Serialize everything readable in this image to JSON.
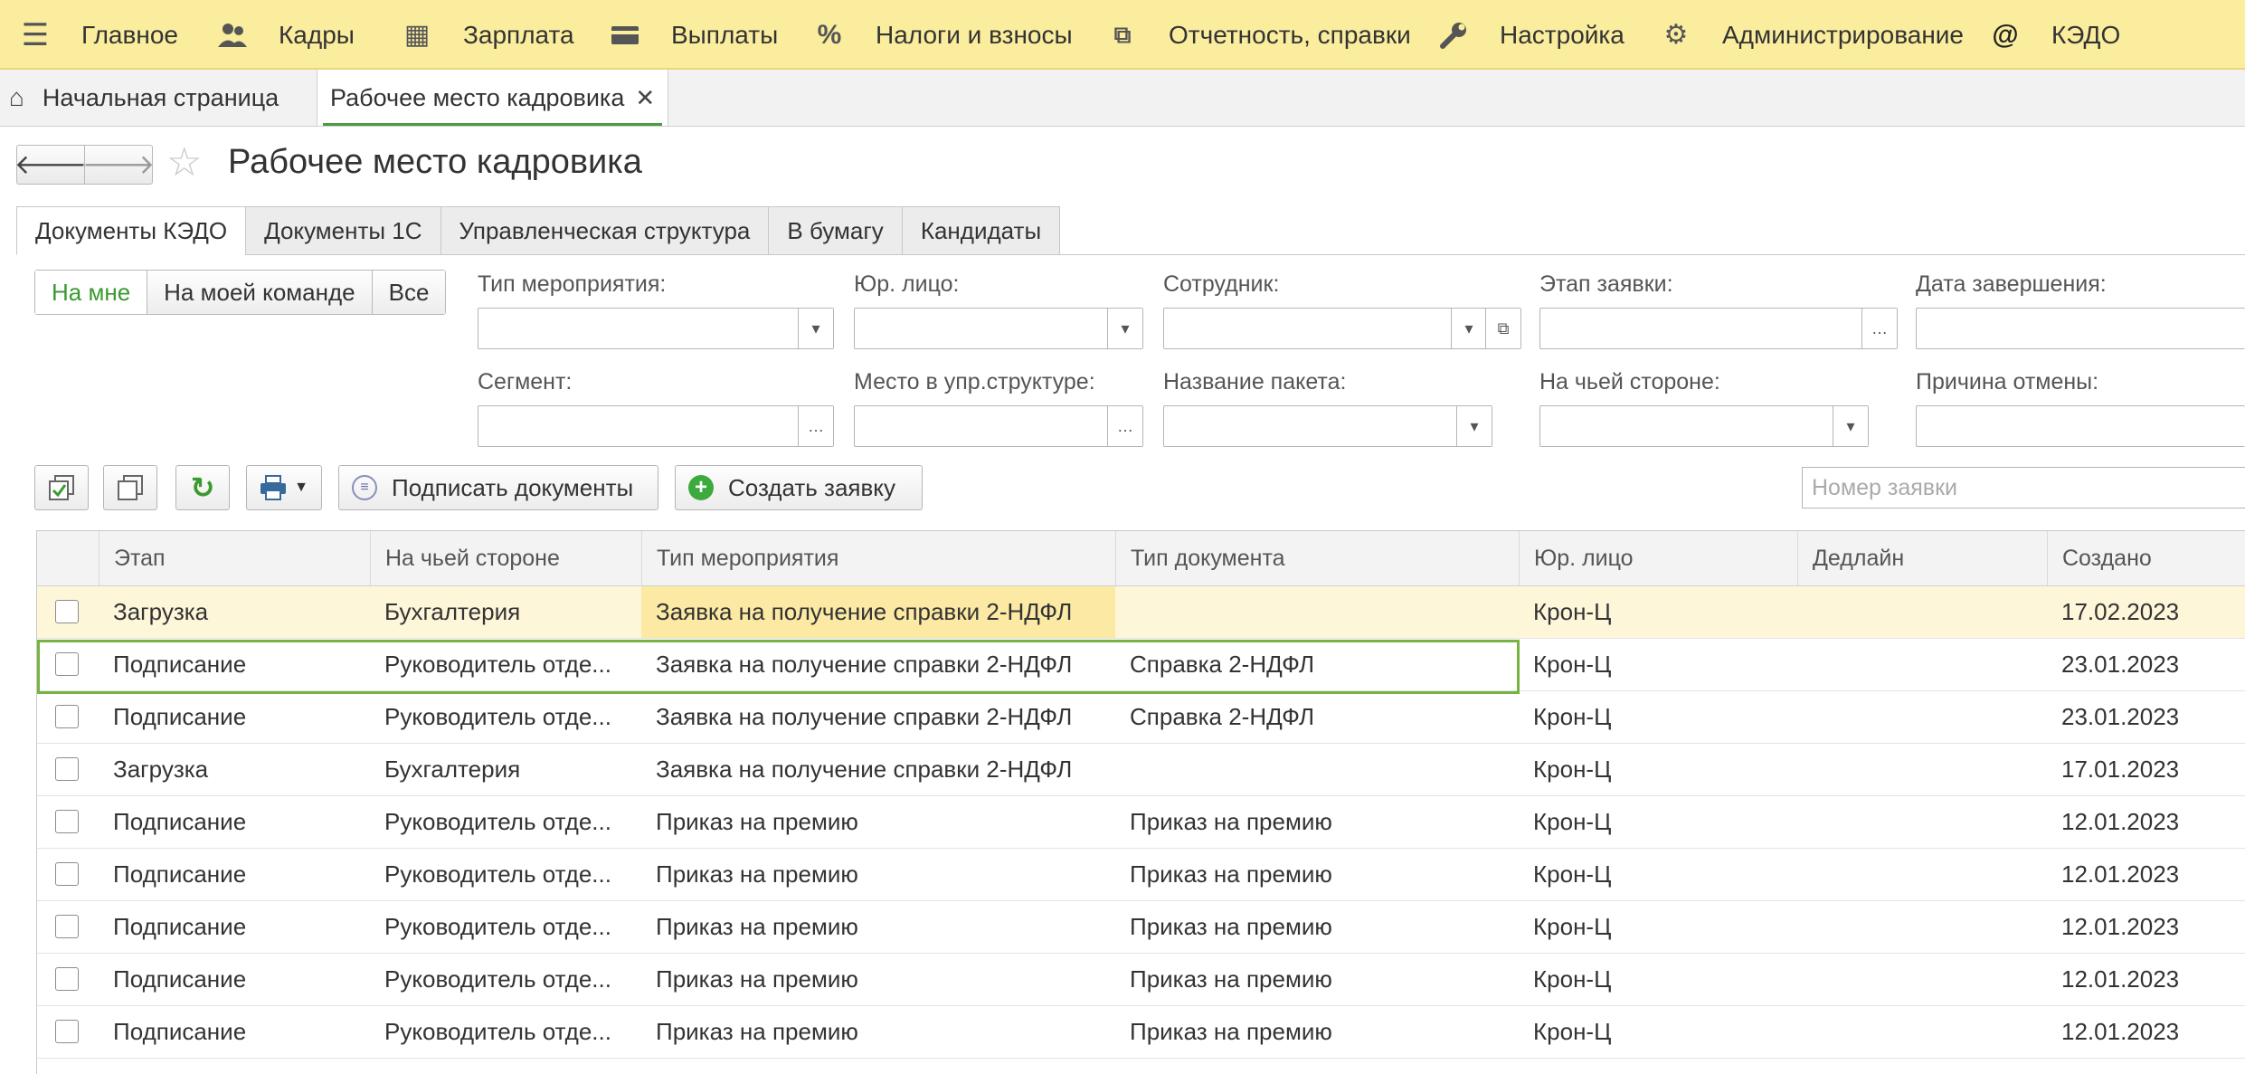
{
  "menu": [
    {
      "label": "Главное",
      "icon": "menu-icon"
    },
    {
      "label": "Кадры",
      "icon": "people-icon"
    },
    {
      "label": "Зарплата",
      "icon": "calculator-icon"
    },
    {
      "label": "Выплаты",
      "icon": "wallet-icon"
    },
    {
      "label": "Налоги и взносы",
      "icon": "percent-icon"
    },
    {
      "label": "Отчетность, справки",
      "icon": "documents-icon"
    },
    {
      "label": "Настройка",
      "icon": "wrench-icon"
    },
    {
      "label": "Администрирование",
      "icon": "gear-icon"
    },
    {
      "label": "КЭДО",
      "icon": "at-icon"
    }
  ],
  "window_tabs": {
    "home": "Начальная страница",
    "current": "Рабочее место кадровика"
  },
  "page": {
    "title": "Рабочее место кадровика"
  },
  "form_tabs": [
    "Документы КЭДО",
    "Документы 1С",
    "Управленческая структура",
    "В бумагу",
    "Кандидаты"
  ],
  "scope": [
    "На мне",
    "На моей команде",
    "Все"
  ],
  "filters": {
    "event_type": "Тип мероприятия:",
    "legal_entity": "Юр. лицо:",
    "employee": "Сотрудник:",
    "stage": "Этап заявки:",
    "end_date": "Дата завершения:",
    "segment": "Сегмент:",
    "mgmt_place": "Место в упр.структуре:",
    "package": "Название пакета:",
    "side": "На чьей стороне:",
    "cancel_reason": "Причина отмены:"
  },
  "toolbar": {
    "sign": "Подписать документы",
    "create": "Создать заявку",
    "search_placeholder": "Номер заявки"
  },
  "table": {
    "columns": [
      "Этап",
      "На чьей стороне",
      "Тип мероприятия",
      "Тип документа",
      "Юр. лицо",
      "Дедлайн",
      "Создано"
    ],
    "rows": [
      [
        "Загрузка",
        "Бухгалтерия",
        "Заявка на получение справки 2-НДФЛ",
        "",
        "Крон-Ц",
        "",
        "17.02.2023"
      ],
      [
        "Подписание",
        "Руководитель отде...",
        "Заявка на получение справки 2-НДФЛ",
        "Справка 2-НДФЛ",
        "Крон-Ц",
        "",
        "23.01.2023"
      ],
      [
        "Подписание",
        "Руководитель отде...",
        "Заявка на получение справки 2-НДФЛ",
        "Справка 2-НДФЛ",
        "Крон-Ц",
        "",
        "23.01.2023"
      ],
      [
        "Загрузка",
        "Бухгалтерия",
        "Заявка на получение справки 2-НДФЛ",
        "",
        "Крон-Ц",
        "",
        "17.01.2023"
      ],
      [
        "Подписание",
        "Руководитель отде...",
        "Приказ на премию",
        "Приказ на премию",
        "Крон-Ц",
        "",
        "12.01.2023"
      ],
      [
        "Подписание",
        "Руководитель отде...",
        "Приказ на премию",
        "Приказ на премию",
        "Крон-Ц",
        "",
        "12.01.2023"
      ],
      [
        "Подписание",
        "Руководитель отде...",
        "Приказ на премию",
        "Приказ на премию",
        "Крон-Ц",
        "",
        "12.01.2023"
      ],
      [
        "Подписание",
        "Руководитель отде...",
        "Приказ на премию",
        "Приказ на премию",
        "Крон-Ц",
        "",
        "12.01.2023"
      ],
      [
        "Подписание",
        "Руководитель отде...",
        "Приказ на премию",
        "Приказ на премию",
        "Крон-Ц",
        "",
        "12.01.2023"
      ]
    ]
  },
  "colors": {
    "topbar": "#fbed9e",
    "accent": "#4a9d3f",
    "highlight_row": "#fdf6d9",
    "highlight_cell": "#fbe9a4"
  }
}
